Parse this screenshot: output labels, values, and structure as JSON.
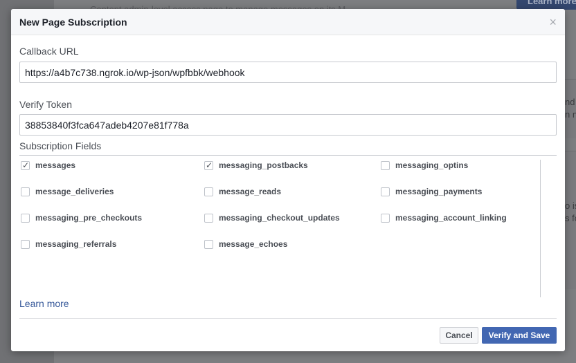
{
  "background": {
    "top_text": "Content admin-level access page to manage messages on its M...",
    "learn_button": "Learn more",
    "side_texts": [
      "nd",
      "n n",
      "o is",
      "s fo"
    ]
  },
  "modal": {
    "title": "New Page Subscription",
    "close_glyph": "×",
    "callback_url": {
      "label": "Callback URL",
      "value": "https://a4b7c738.ngrok.io/wp-json/wpfbbk/webhook"
    },
    "verify_token": {
      "label": "Verify Token",
      "value": "38853840f3fca647adeb4207e81f778a"
    },
    "subscription_fields": {
      "label": "Subscription Fields",
      "fields": [
        {
          "name": "messages",
          "checked": true
        },
        {
          "name": "messaging_postbacks",
          "checked": true
        },
        {
          "name": "messaging_optins",
          "checked": false
        },
        {
          "name": "message_deliveries",
          "checked": false
        },
        {
          "name": "message_reads",
          "checked": false
        },
        {
          "name": "messaging_payments",
          "checked": false
        },
        {
          "name": "messaging_pre_checkouts",
          "checked": false
        },
        {
          "name": "messaging_checkout_updates",
          "checked": false
        },
        {
          "name": "messaging_account_linking",
          "checked": false
        },
        {
          "name": "messaging_referrals",
          "checked": false
        },
        {
          "name": "message_echoes",
          "checked": false
        }
      ]
    },
    "learn_more": "Learn more",
    "buttons": {
      "cancel": "Cancel",
      "verify_save": "Verify and Save"
    }
  },
  "colors": {
    "primary": "#4267b2",
    "link": "#365899",
    "text": "#4b4f56"
  }
}
